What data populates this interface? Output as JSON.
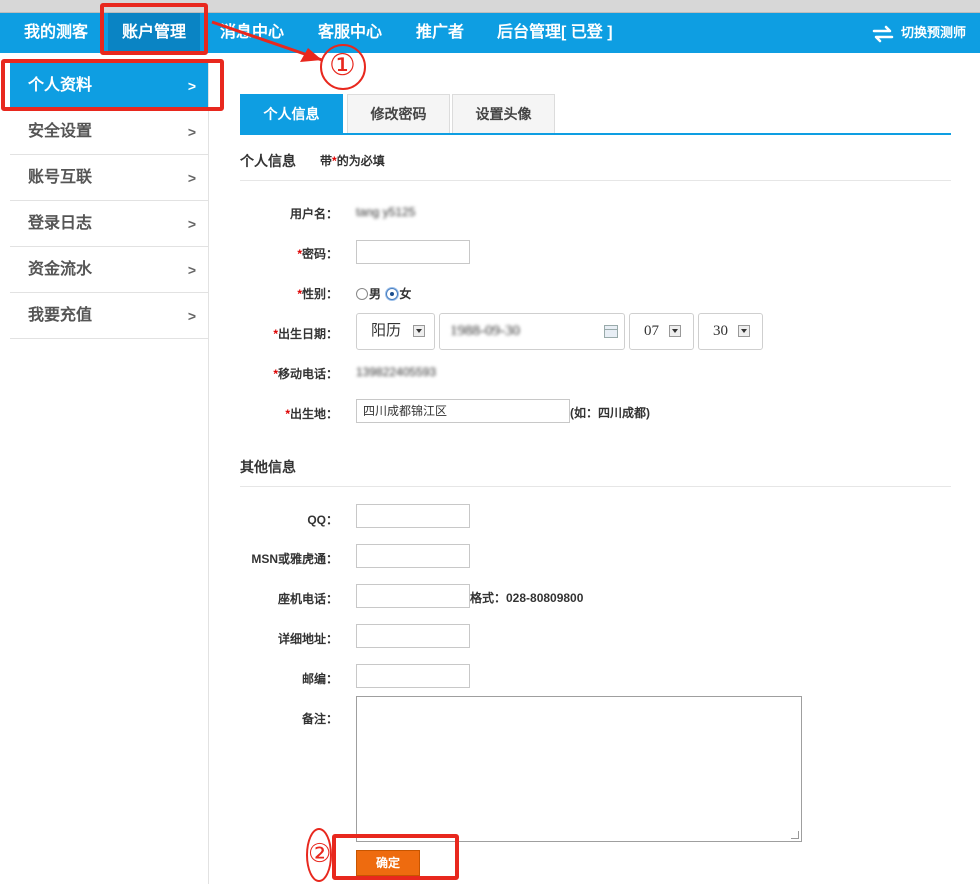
{
  "topnav": {
    "items": [
      "我的测客",
      "账户管理",
      "消息中心",
      "客服中心",
      "推广者",
      "后台管理[ 已登 ]"
    ],
    "switch_label": "切换预测师"
  },
  "sidebar": {
    "items": [
      "个人资料",
      "安全设置",
      "账号互联",
      "登录日志",
      "资金流水",
      "我要充值"
    ],
    "arrow": ">"
  },
  "tabs": [
    "个人信息",
    "修改密码",
    "设置头像"
  ],
  "personal": {
    "title": "个人信息",
    "note_prefix": "带",
    "note_star": "*",
    "note_suffix": "的为必填",
    "star": "*",
    "username_label": "用户名：",
    "username_value": "tang    y5125",
    "password_label": "密码：",
    "password_value": "",
    "gender_label": "性别：",
    "gender_male": "男",
    "gender_female": "女",
    "gender_selected": "女",
    "birthdate_label": "出生日期：",
    "calendar_type": "阳历",
    "birth_date_value": "1988-09-30",
    "month": "07",
    "day": "30",
    "mobile_label": "移动电话：",
    "mobile_value": "139822405593",
    "birthplace_label": "出生地：",
    "birthplace_value": "四川成都锦江区",
    "birthplace_hint": "(如：四川成都)"
  },
  "other": {
    "title": "其他信息",
    "qq_label": "QQ：",
    "msn_label": "MSN或雅虎通：",
    "landline_label": "座机电话：",
    "landline_hint": "格式：028-80809800",
    "address_label": "详细地址：",
    "postcode_label": "邮编：",
    "remark_label": "备注："
  },
  "submit_label": "确定",
  "annotations": [
    "①",
    "②"
  ],
  "colors": {
    "nav_blue": "#0e9ee2",
    "nav_active": "#0a84c4",
    "required_red": "#dd0000",
    "submit_orange": "#ee6b0f",
    "annotation_red": "#e8281e"
  }
}
